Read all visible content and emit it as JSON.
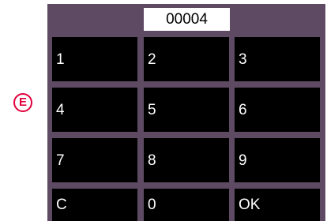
{
  "marker": {
    "label": "E"
  },
  "keypad": {
    "display_value": "00004",
    "keys": {
      "k1": "1",
      "k2": "2",
      "k3": "3",
      "k4": "4",
      "k5": "5",
      "k6": "6",
      "k7": "7",
      "k8": "8",
      "k9": "9",
      "clear": "C",
      "k0": "0",
      "ok": "OK"
    }
  },
  "colors": {
    "panel": "#5e4b63",
    "key_bg": "#000000",
    "key_text": "#ffffff",
    "display_bg": "#ffffff",
    "marker": "#e2003b"
  }
}
